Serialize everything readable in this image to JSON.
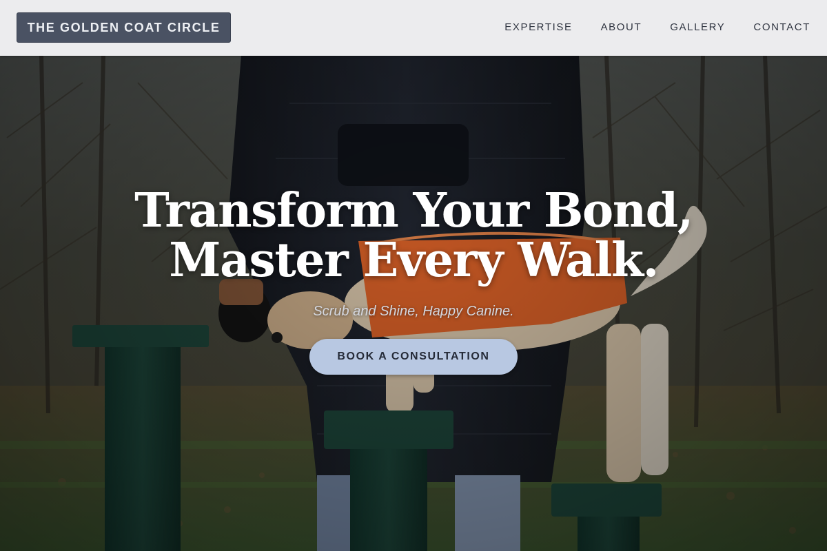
{
  "header": {
    "logo_text": "THE GOLDEN COAT CIRCLE",
    "nav": [
      {
        "label": "EXPERTISE"
      },
      {
        "label": "ABOUT"
      },
      {
        "label": "GALLERY"
      },
      {
        "label": "CONTACT"
      }
    ]
  },
  "hero": {
    "headline_line1": "Transform Your Bond,",
    "headline_line2": "Master Every Walk.",
    "tagline": "Scrub and Shine, Happy Canine.",
    "cta_label": "BOOK A CONSULTATION",
    "background_image": "person in dark puffer jacket training a dog in an orange coat on green wooden posts in a forest park"
  },
  "colors": {
    "header_bg": "#f4f4f6",
    "logo_bg": "#4a5263",
    "cta_bg": "#b8c8e2",
    "cta_text": "#252b38",
    "headline": "#ffffff",
    "dog_coat": "#e8672a",
    "posts": "#1f4a3e"
  }
}
